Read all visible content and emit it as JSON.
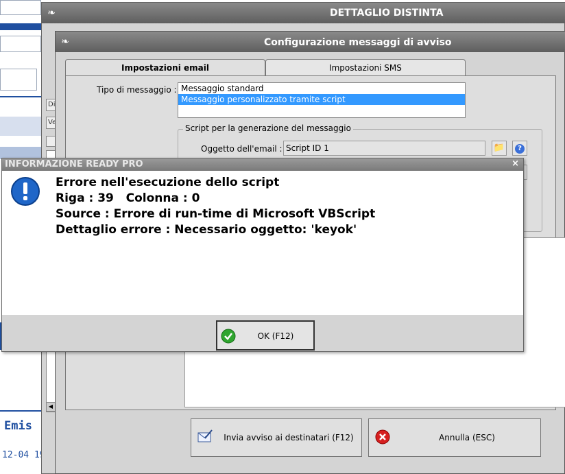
{
  "background": {
    "tags": [
      "Di",
      "Ve"
    ],
    "emis_label": "Emis",
    "date_fragment": "12-04 19"
  },
  "distinta_window": {
    "title": "DETTAGLIO DISTINTA"
  },
  "config_window": {
    "title": "Configurazione messaggi di avviso",
    "tabs": [
      {
        "label": "Impostazioni email",
        "active": true
      },
      {
        "label": "Impostazioni SMS",
        "active": false
      }
    ],
    "tipo_label": "Tipo di messaggio :",
    "message_types": [
      {
        "label": "Messaggio standard",
        "selected": false
      },
      {
        "label": "Messaggio personalizzato tramite script",
        "selected": true
      }
    ],
    "script_group_label": "Script per la generazione del messaggio",
    "oggetto_label": "Oggetto dell'email :",
    "oggetto_value": "Script ID 1",
    "send_button": "Invia avviso ai destinatari (F12)",
    "cancel_button": "Annulla (ESC)"
  },
  "error_dialog": {
    "title": "INFORMAZIONE READY PRO",
    "close_glyph": "×",
    "lines": [
      "Errore nell'esecuzione dello script",
      "Riga : 39   Colonna : 0",
      "Source : Errore di run-time di Microsoft VBScript",
      "Dettaglio errore : Necessario oggetto: 'keyok'"
    ],
    "ok_button": "OK (F12)",
    "icon": "info-exclamation-icon"
  },
  "colors": {
    "accent_blue": "#1f4fa0",
    "selection": "#3399ff",
    "title_bar": "#6e6e6e"
  }
}
